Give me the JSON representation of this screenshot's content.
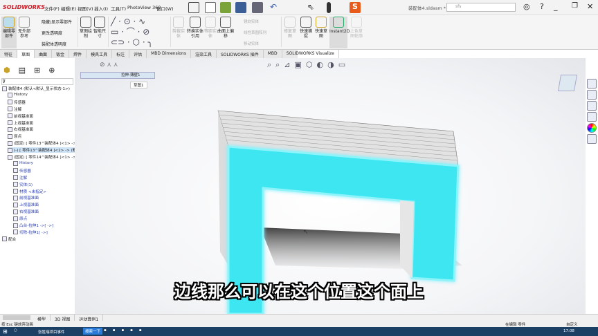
{
  "app": {
    "brand": "SOLIDWORKS",
    "doc_title": "装配体4.sldasm *",
    "search_placeholder": "sfs"
  },
  "menu": [
    "文件(F)",
    "编辑(E)",
    "视图(V)",
    "插入(I)",
    "工具(T)",
    "PhotoView 360",
    "窗口(W)"
  ],
  "ribbon": {
    "buttons": [
      "编辑零部件",
      "无外部参考",
      "草图绘制",
      "智能尺寸",
      "剪裁实体",
      "转换实体引用",
      "等距实体",
      "曲面上偏移",
      "快速捕捉",
      "快速草图",
      "Instant2D",
      "上色草图轮廓",
      "修复草图"
    ],
    "small": [
      "隐藏/显示零部件",
      "更改透明度",
      "装配体透明度",
      "镜向实体",
      "线性草图阵列",
      "移动实体"
    ]
  },
  "tabs": [
    "特征",
    "草图",
    "曲面",
    "钣金",
    "焊件",
    "模具工具",
    "标注",
    "评估",
    "MBD Dimensions",
    "渲染工具",
    "SOLIDWORKS 插件",
    "MBD",
    "SOLIDWORKS Visualize"
  ],
  "active_tab": "草图",
  "breadcrumb": {
    "item": "拉伸-薄壁1",
    "sketch": "草图1"
  },
  "tree": [
    {
      "label": "装配体4 (默认<默认_显示状态-1>)",
      "level": 0
    },
    {
      "label": "History",
      "level": 1
    },
    {
      "label": "传感器",
      "level": 1
    },
    {
      "label": "注解",
      "level": 1
    },
    {
      "label": "前视基准面",
      "level": 1
    },
    {
      "label": "上视基准面",
      "level": 1
    },
    {
      "label": "右视基准面",
      "level": 1
    },
    {
      "label": "原点",
      "level": 1
    },
    {
      "label": "(固定) [ 零件13^装配体4 ]<1> ->",
      "level": 1
    },
    {
      "label": "(-) [ 零件13^装配体4 ]<2> -> (默认",
      "level": 1,
      "selected": true
    },
    {
      "label": "(固定) [ 零件14^装配体4 ]<1> ->",
      "level": 1
    },
    {
      "label": "History",
      "level": 2
    },
    {
      "label": "传感器",
      "level": 2
    },
    {
      "label": "注解",
      "level": 2
    },
    {
      "label": "实体(1)",
      "level": 2
    },
    {
      "label": "材质 <未指定>",
      "level": 2
    },
    {
      "label": "前视基准面",
      "level": 2
    },
    {
      "label": "上视基准面",
      "level": 2
    },
    {
      "label": "右视基准面",
      "level": 2
    },
    {
      "label": "原点",
      "level": 2
    },
    {
      "label": "凸台-拉伸1 ->[ ->]",
      "level": 2
    },
    {
      "label": "切除-拉伸1[ ->]",
      "level": 2
    },
    {
      "label": "配合",
      "level": 0
    }
  ],
  "bottom_tabs": [
    "模型",
    "3D 视图",
    "运动算例1"
  ],
  "status": {
    "left": "按 Esc 键放弃动画",
    "mode": "在编辑 零件",
    "custom": "自定义"
  },
  "taskbar": {
    "app": "张胜瑞项目事件",
    "search": "搜索一下",
    "time": "17:08"
  },
  "subtitle": "边线那么可以在这个位置这个面上",
  "colors": {
    "highlight": "#3ee6f2",
    "brand": "#d0202a"
  }
}
